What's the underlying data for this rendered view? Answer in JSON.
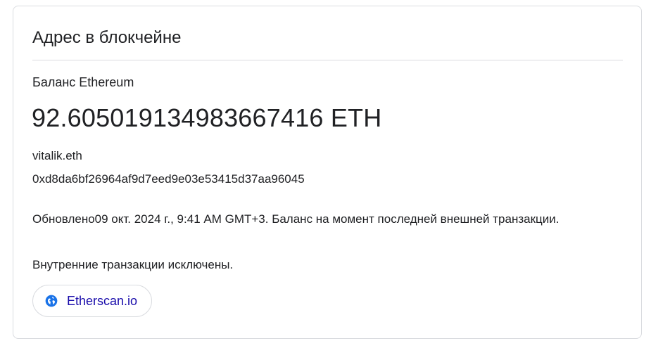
{
  "card": {
    "title": "Адрес в блокчейне",
    "balance_label": "Баланс Ethereum",
    "balance_value": "92.605019134983667416 ETH",
    "ens_name": "vitalik.eth",
    "address": "0xd8da6bf26964af9d7eed9e03e53415d37aa96045",
    "updated_text": "Обновлено09 окт. 2024 г., 9:41 AM GMT+3. Баланс на момент последней внешней транзакции.",
    "internal_note": "Внутренние транзакции исключены.",
    "source_link": {
      "label": "Etherscan.io",
      "icon": "globe-icon",
      "color": "#1a0dab"
    }
  },
  "colors": {
    "text": "#202124",
    "border": "#dadce0",
    "link": "#1a0dab",
    "icon": "#1a73e8"
  }
}
